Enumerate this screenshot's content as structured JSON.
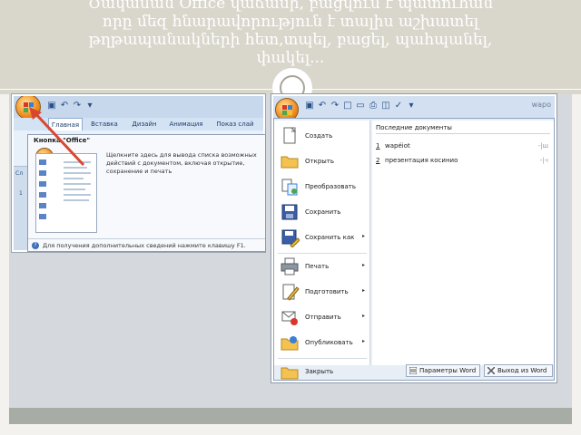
{
  "slide": {
    "title_lines": [
      "Ծակաման Office վաճասի, բացվում է պատուհան",
      "որը մեզ հնարավորություն է տալիս աշխատել",
      "թղթապանակների հետ,տպել, բացել, պահպանել,",
      "փակել..."
    ]
  },
  "left_shot": {
    "tabs": [
      "Главная",
      "Вставка",
      "Дизайн",
      "Анимация",
      "Показ слай"
    ],
    "tooltip_title": "Кнопка \"Office\"",
    "tooltip_desc": "Щелкните здесь для вывода списка возможных действий с документом, включая открытие, сохранение и печать",
    "tooltip_footer": "Для получения дополнительных сведений нажмите клавишу F1.",
    "side_label_1": "Сл",
    "side_label_2": "1",
    "help_glyph": "?"
  },
  "right_shot": {
    "window_title": "wapo",
    "menu_items": [
      {
        "label": "Создать",
        "icon": "new-document-icon",
        "arrow": false
      },
      {
        "label": "Открыть",
        "icon": "open-folder-icon",
        "arrow": false
      },
      {
        "label": "Преобразовать",
        "icon": "convert-icon",
        "arrow": false
      },
      {
        "label": "Сохранить",
        "icon": "save-icon",
        "arrow": false
      },
      {
        "label": "Сохранить как",
        "icon": "save-as-icon",
        "arrow": true
      },
      {
        "label": "Печать",
        "icon": "print-icon",
        "arrow": true
      },
      {
        "label": "Подготовить",
        "icon": "prepare-icon",
        "arrow": true
      },
      {
        "label": "Отправить",
        "icon": "send-icon",
        "arrow": true
      },
      {
        "label": "Опубликовать",
        "icon": "publish-icon",
        "arrow": true
      },
      {
        "label": "Закрыть",
        "icon": "close-folder-icon",
        "arrow": false
      }
    ],
    "recent_title": "Последние документы",
    "recent_docs": [
      {
        "num": "1",
        "name": "wapéiot",
        "pin": "-|ш"
      },
      {
        "num": "2",
        "name": "презентация косинио",
        "pin": "-|-ı"
      }
    ],
    "options_button": "Параметры Word",
    "exit_button": "Выход из Word"
  },
  "colors": {
    "header_bg": "#d9d6cc",
    "accent_orange": "#f08a1d",
    "arrow_red": "#d9472f",
    "ribbon_blue": "#c7d8ed"
  }
}
